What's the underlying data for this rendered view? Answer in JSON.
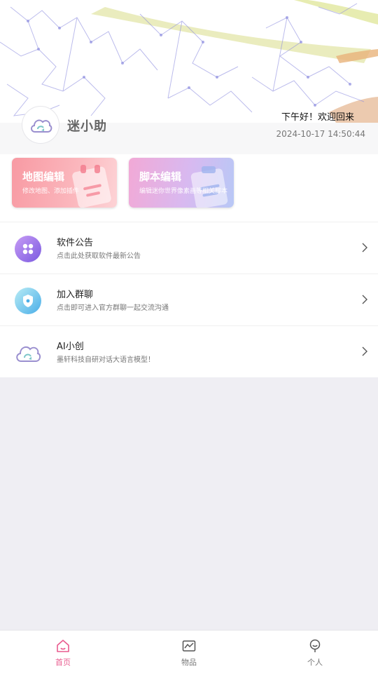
{
  "header": {
    "app_name": "迷小助",
    "greeting": "下午好！欢迎回来",
    "datetime": "2024-10-17 14:50:44"
  },
  "cards": [
    {
      "title": "地图编辑",
      "subtitle": "修改地图、添加插件"
    },
    {
      "title": "脚本编辑",
      "subtitle": "编辑迷你世界像素画等相关脚本"
    }
  ],
  "list": [
    {
      "title": "软件公告",
      "desc": "点击此处获取软件最新公告",
      "icon": "announcement-icon"
    },
    {
      "title": "加入群聊",
      "desc": "点击即可进入官方群聊一起交流沟通",
      "icon": "shield-icon"
    },
    {
      "title": "AI小创",
      "desc": "墨轩科技自研对话大语言模型！",
      "icon": "cloud-logo-icon"
    }
  ],
  "tabbar": [
    {
      "label": "首页",
      "icon": "home-icon",
      "active": true
    },
    {
      "label": "物品",
      "icon": "chart-icon",
      "active": false
    },
    {
      "label": "个人",
      "icon": "person-icon",
      "active": false
    }
  ],
  "colors": {
    "accent": "#e95c8f",
    "background": "#efeef3"
  }
}
